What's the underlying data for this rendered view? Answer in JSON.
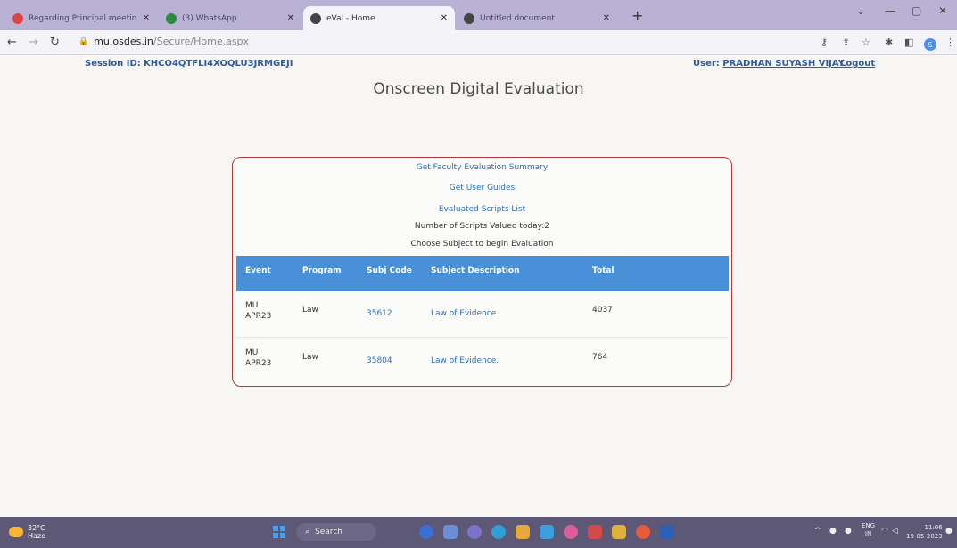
{
  "browser": {
    "tabs": [
      {
        "label": "Regarding Principal meeting for",
        "favicon_color": "#d44"
      },
      {
        "label": "(3) WhatsApp",
        "favicon_color": "#2a8a3e"
      },
      {
        "label": "eVal - Home",
        "favicon_color": "#444"
      },
      {
        "label": "Untitled document",
        "favicon_color": "#444"
      }
    ],
    "url_host": "mu.osdes.in",
    "url_path": "/Secure/Home.aspx"
  },
  "header": {
    "session_label": "Session ID:",
    "session_id": "KHCO4QTFLI4XOQLU3JRMGEJI",
    "user_label": "User:",
    "user_name": "PRADHAN SUYASH VIJAY",
    "logout": "Logout"
  },
  "page_title": "Onscreen Digital Evaluation",
  "card": {
    "links": [
      "Get Faculty Evaluation Summary",
      "Get User Guides",
      "Evaluated Scripts List"
    ],
    "scripts_today": "Number of Scripts Valued today:2",
    "instruction": "Choose Subject to begin Evaluation"
  },
  "table": {
    "headers": [
      "Event",
      "Program",
      "Subj Code",
      "Subject Description",
      "Total"
    ],
    "rows": [
      {
        "event_line1": "MU",
        "event_line2": "APR23",
        "program": "Law",
        "code": "35612",
        "description": "Law of Evidence",
        "total": "4037"
      },
      {
        "event_line1": "MU",
        "event_line2": "APR23",
        "program": "Law",
        "code": "35804",
        "description": "Law of Evidence.",
        "total": "764"
      }
    ]
  },
  "taskbar": {
    "temperature": "32°C",
    "weather": "Haze",
    "search": "Search",
    "lang1": "ENG",
    "lang2": "IN",
    "time": "11:06",
    "date": "19-05-2023"
  }
}
